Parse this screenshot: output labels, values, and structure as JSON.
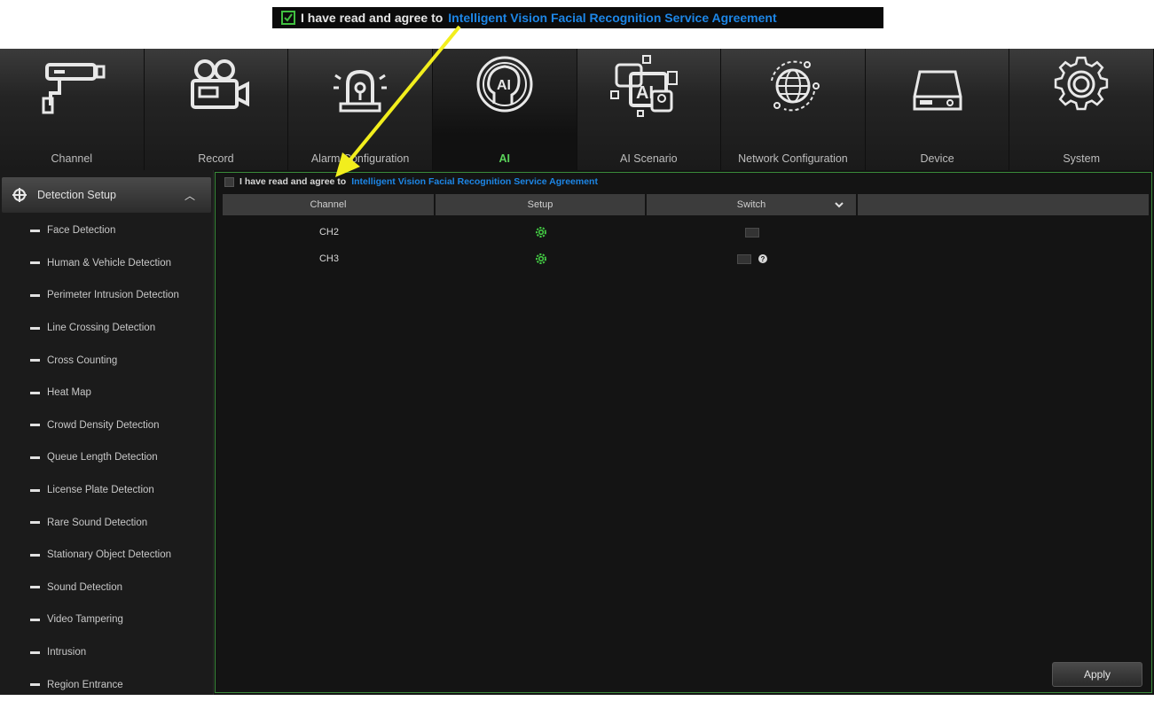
{
  "callout": {
    "text": "I have read and agree to",
    "link": "Intelligent Vision Facial Recognition Service Agreement"
  },
  "nav": {
    "tabs": [
      {
        "label": "Channel",
        "icon": "camera-icon"
      },
      {
        "label": "Record",
        "icon": "video-camera-icon"
      },
      {
        "label": "Alarm Configuration",
        "icon": "alarm-siren-icon"
      },
      {
        "label": "AI",
        "icon": "ai-head-icon",
        "active": true
      },
      {
        "label": "AI Scenario",
        "icon": "ai-scenario-icon"
      },
      {
        "label": "Network Configuration",
        "icon": "globe-icon"
      },
      {
        "label": "Device",
        "icon": "hard-drive-icon"
      },
      {
        "label": "System",
        "icon": "gear-icon"
      }
    ]
  },
  "sidebar": {
    "header": "Detection Setup",
    "items": [
      "Face Detection",
      "Human & Vehicle Detection",
      "Perimeter Intrusion Detection",
      "Line Crossing Detection",
      "Cross Counting",
      "Heat Map",
      "Crowd Density Detection",
      "Queue Length Detection",
      "License Plate Detection",
      "Rare Sound Detection",
      "Stationary Object Detection",
      "Sound Detection",
      "Video Tampering",
      "Intrusion",
      "Region Entrance"
    ]
  },
  "main": {
    "agree_text": "I have read and agree to",
    "agree_link": "Intelligent Vision Facial Recognition Service Agreement",
    "columns": [
      "Channel",
      "Setup",
      "Switch"
    ],
    "rows": [
      {
        "channel": "CH2"
      },
      {
        "channel": "CH3"
      }
    ],
    "apply_label": "Apply"
  },
  "colors": {
    "accent_green": "#5ad35a",
    "link_blue": "#1d86e6",
    "arrow_yellow": "#f2ee1d"
  }
}
